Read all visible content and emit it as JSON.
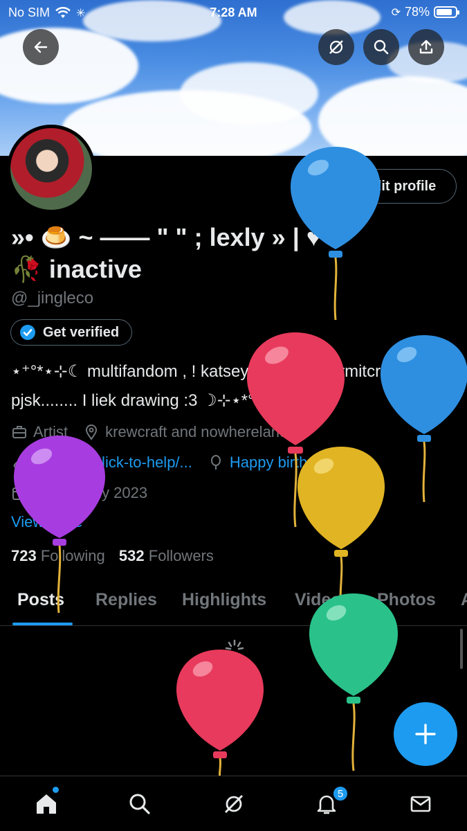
{
  "status": {
    "carrier": "No SIM",
    "time": "7:28 AM",
    "battery": "78%"
  },
  "profile": {
    "edit_label": "Edit profile",
    "name_line1": "»• 🍮 ~ —— \" \" ; lexly » | ♥",
    "name_line2": "🥀 inactive",
    "handle": "@_jingleco",
    "verified_label": "Get verified",
    "bio_line1": "⋆⁺°*⋆⊹☾ multifandom , ! katseye , alnst , hermitcraft,",
    "bio_line2": "pjsk........ I liek drawing :3 ☽⊹⋆*°⁺⋆",
    "job": "Artist",
    "location": "krewcraft and nowhereland",
    "link": "arab.org/click-to-help/...",
    "birthday": "Happy birthday!",
    "joined": "Joined July 2023",
    "view_more": "View more",
    "following_count": "723",
    "following_label": "Following",
    "followers_count": "532",
    "followers_label": "Followers"
  },
  "tabs": [
    "Posts",
    "Replies",
    "Highlights",
    "Videos",
    "Photos",
    "A"
  ],
  "notifications_badge": "5",
  "colors": {
    "accent": "#1d9bf0",
    "background": "#000000",
    "muted": "#71767b"
  }
}
